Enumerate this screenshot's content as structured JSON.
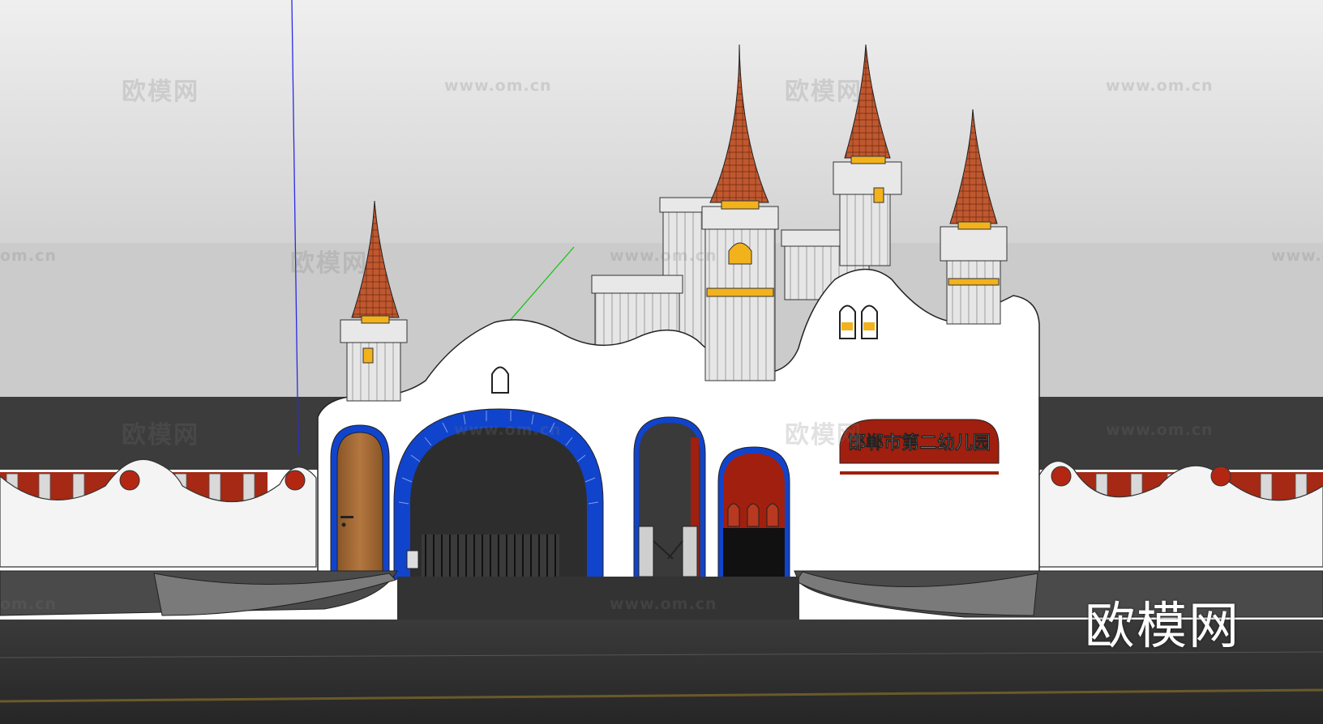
{
  "scene": {
    "sign_text": "邯郸市第二幼儿园",
    "colors": {
      "sky_top": "#d9d9d9",
      "roof": "#b5502a",
      "wall": "#ffffff",
      "arch_blue": "#1144cc",
      "sign_red": "#a01f0e",
      "window_yellow": "#f2b21c",
      "wood_door": "#a36a37",
      "road": "#2e2e2e"
    }
  },
  "watermarks": {
    "logo_text": "欧模网",
    "url_text": "www.om.cn",
    "url_partial": "om.cn"
  },
  "brand": {
    "logo_text": "欧模网"
  }
}
